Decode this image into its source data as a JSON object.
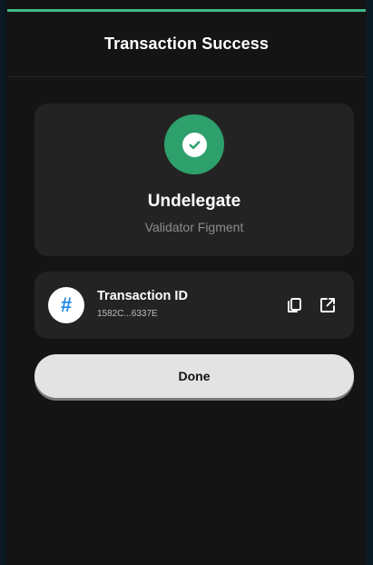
{
  "header": {
    "title": "Transaction Success"
  },
  "result": {
    "status_icon": "check-circle-icon",
    "title": "Undelegate",
    "subtitle": "Validator Figment"
  },
  "transaction": {
    "icon": "hash-icon",
    "icon_glyph": "#",
    "label": "Transaction ID",
    "value": "1582C...6337E",
    "actions": [
      "copy-icon",
      "external-link-icon"
    ]
  },
  "done_button": {
    "label": "Done"
  },
  "colors": {
    "accent": "#3dbb86",
    "success": "#2ea06b",
    "card": "#232323",
    "background": "#141414",
    "hash_icon": "#1e88e5"
  }
}
